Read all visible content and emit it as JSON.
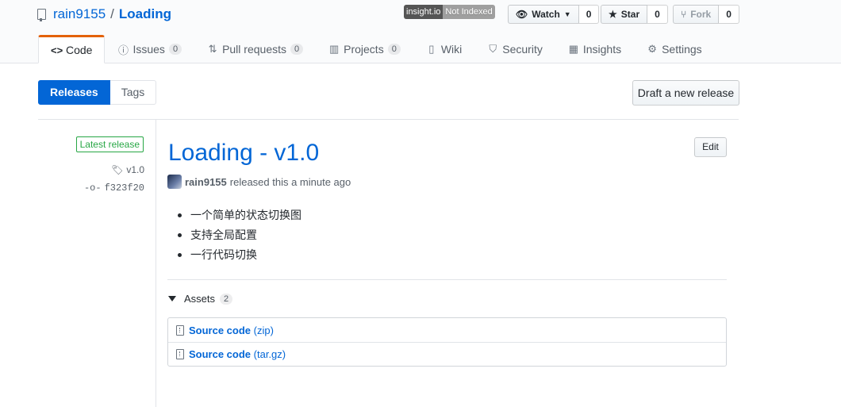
{
  "repo": {
    "owner": "rain9155",
    "separator": "/",
    "name": "Loading"
  },
  "badge": {
    "left": "insight.io",
    "right": "Not Indexed"
  },
  "actions": {
    "watch_label": "Watch",
    "watch_count": "0",
    "star_label": "Star",
    "star_count": "0",
    "fork_label": "Fork",
    "fork_count": "0"
  },
  "tabs": [
    {
      "label": "Code",
      "icon": "code-icon"
    },
    {
      "label": "Issues",
      "count": "0",
      "icon": "issue-icon"
    },
    {
      "label": "Pull requests",
      "count": "0",
      "icon": "pull-request-icon"
    },
    {
      "label": "Projects",
      "count": "0",
      "icon": "project-icon"
    },
    {
      "label": "Wiki",
      "icon": "book-icon"
    },
    {
      "label": "Security",
      "icon": "shield-icon"
    },
    {
      "label": "Insights",
      "icon": "graph-icon"
    },
    {
      "label": "Settings",
      "icon": "gear-icon"
    }
  ],
  "subnav": {
    "releases": "Releases",
    "tags": "Tags",
    "draft": "Draft a new release"
  },
  "release": {
    "latest_label": "Latest release",
    "tag": "v1.0",
    "commit": "f323f20",
    "title": "Loading - v1.0",
    "edit": "Edit",
    "author": "rain9155",
    "released_text": "released this a minute ago",
    "notes": [
      "一个简单的状态切换图",
      "支持全局配置",
      "一行代码切换"
    ]
  },
  "assets": {
    "label": "Assets",
    "count": "2",
    "items": [
      {
        "name": "Source code",
        "ext": "(zip)"
      },
      {
        "name": "Source code",
        "ext": "(tar.gz)"
      }
    ]
  },
  "colors": {
    "accent": "#0366d6",
    "tab_highlight": "#e36209",
    "latest_green": "#28a745"
  }
}
